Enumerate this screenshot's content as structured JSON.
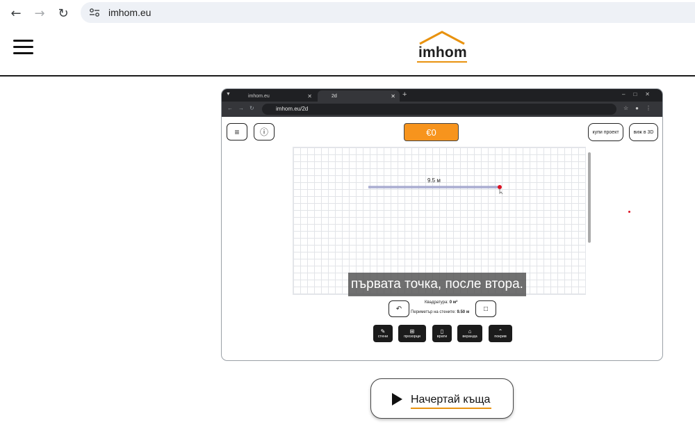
{
  "browser": {
    "url": "imhom.eu",
    "icons": {
      "back": "back-arrow-icon",
      "forward": "forward-arrow-icon",
      "reload": "reload-icon",
      "site_info": "tune-icon"
    }
  },
  "header": {
    "logo_text": "imhom",
    "menu_icon": "hamburger-menu-icon",
    "accent_color": "#e8920f"
  },
  "video": {
    "tabs": [
      {
        "title": "imhom.eu"
      },
      {
        "title": "2d"
      }
    ],
    "address": "imhom.eu/2d",
    "app": {
      "price": "€0",
      "buy_button": "купи проект",
      "view3d_button": "виж в 3D",
      "wall_length": "9.5 м",
      "subtitle": "първата точка, после втора.",
      "stats": {
        "area_label": "Квадратура:",
        "area_value": "0 м²",
        "perimeter_label": "Периметър на стените:",
        "perimeter_value": "9.50 м"
      },
      "tools": [
        {
          "label": "стени",
          "icon": "wall-tool-icon"
        },
        {
          "label": "прозорци",
          "icon": "window-icon"
        },
        {
          "label": "врати",
          "icon": "door-icon"
        },
        {
          "label": "веранда",
          "icon": "veranda-icon"
        },
        {
          "label": "покрив",
          "icon": "roof-icon"
        }
      ],
      "accent_color": "#f7941d"
    }
  },
  "cta": {
    "label": "Начертай къща",
    "icon": "play-icon"
  }
}
